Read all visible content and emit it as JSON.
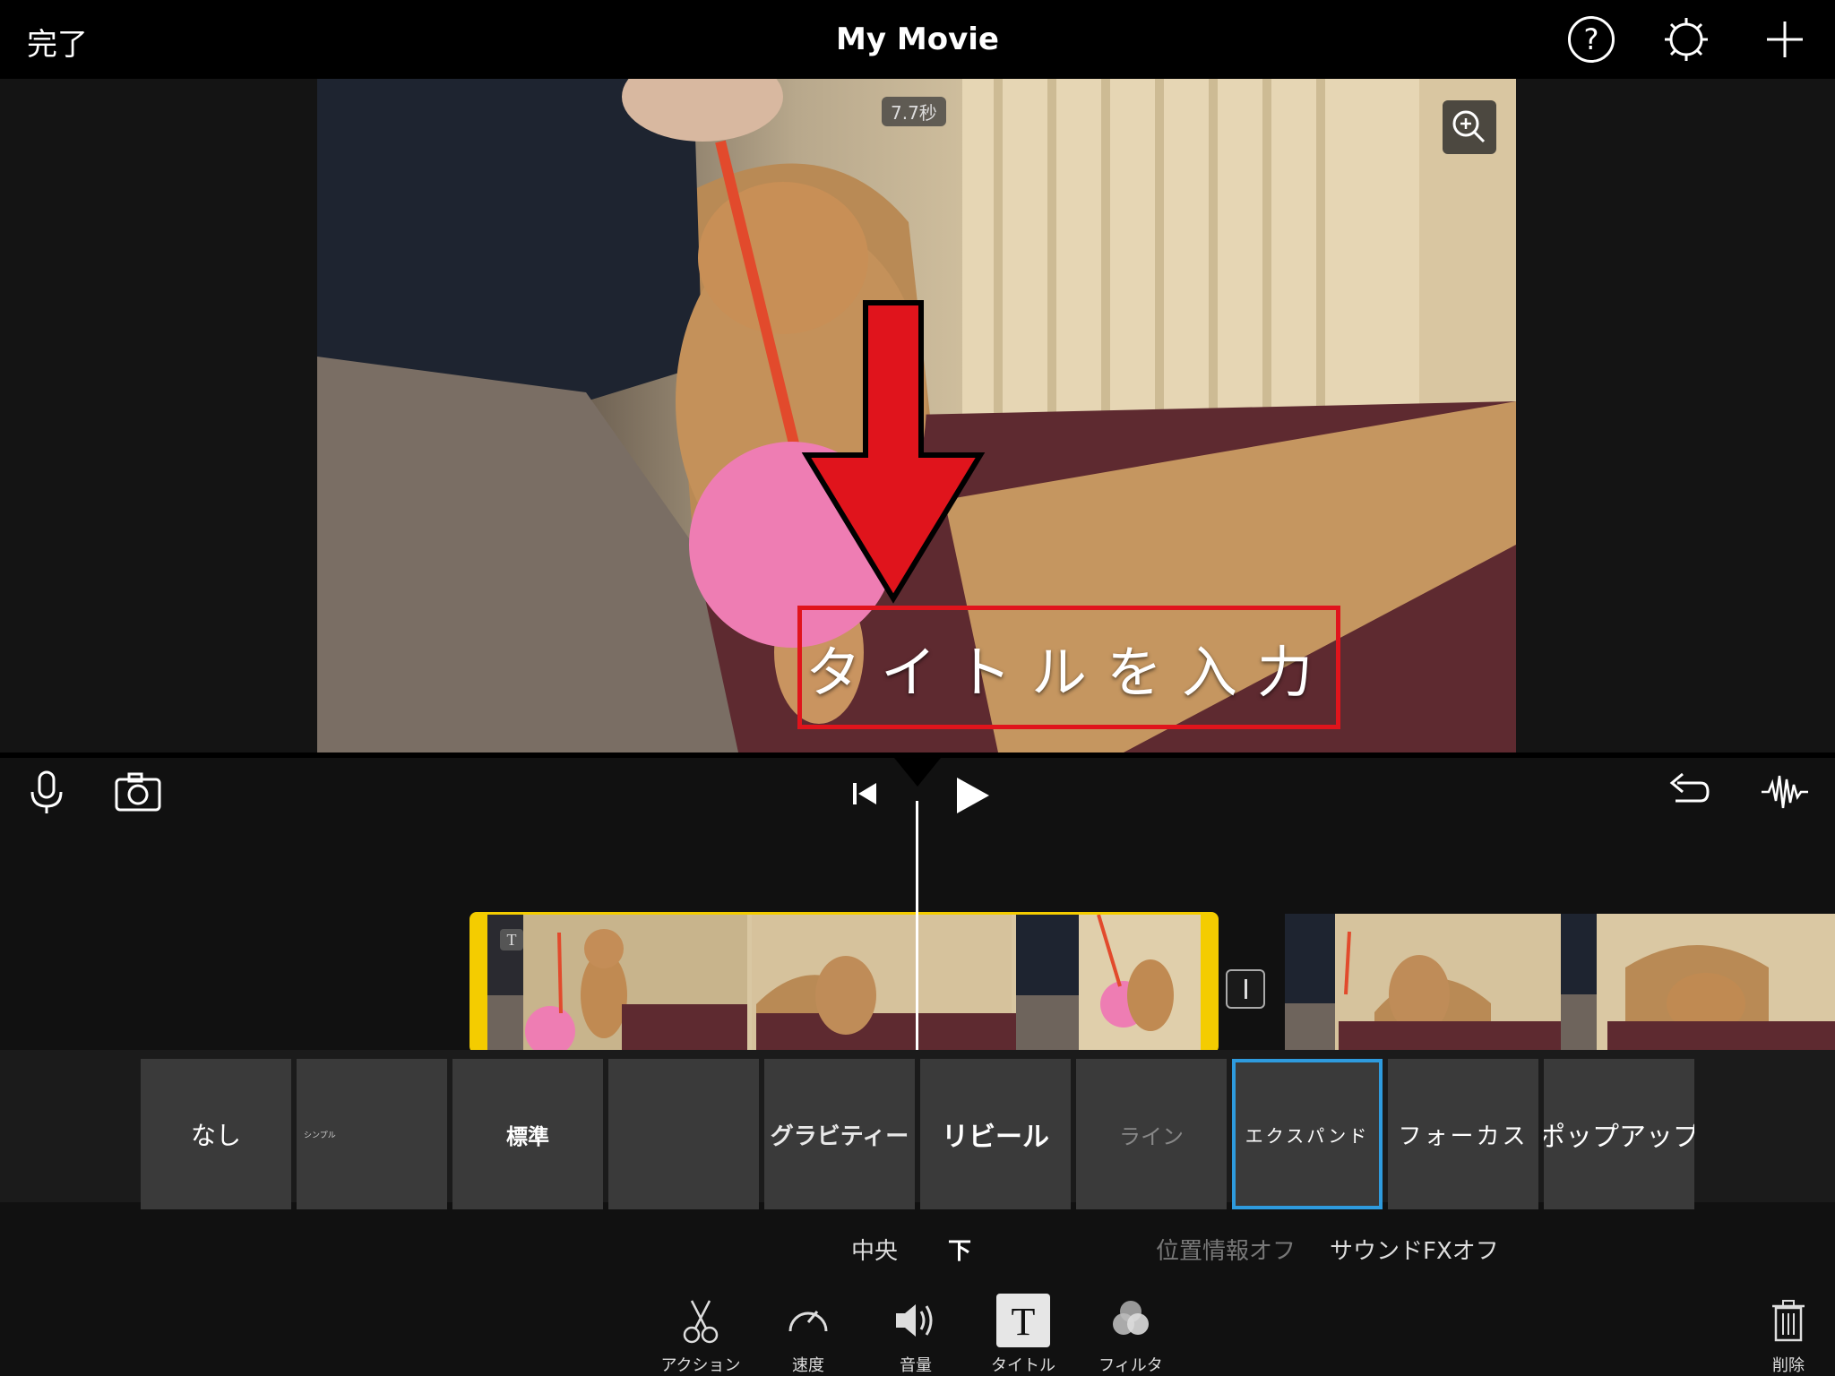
{
  "top_bar": {
    "done_label": "完了",
    "title": "My Movie",
    "help_label": "?"
  },
  "viewer": {
    "duration": "7.7秒",
    "title_placeholder": "タイトルを入力"
  },
  "title_styles": [
    {
      "label": "なし"
    },
    {
      "label": "シンプル"
    },
    {
      "label": "標準"
    },
    {
      "label": ""
    },
    {
      "label": "グラビティー"
    },
    {
      "label": "リビール"
    },
    {
      "label": "ライン"
    },
    {
      "label": "エクスパンド",
      "selected": true
    },
    {
      "label": "フォーカス"
    },
    {
      "label": "ポップアップ"
    }
  ],
  "position_options": {
    "center": "中央",
    "bottom": "下",
    "location_info": "位置情報オフ",
    "sound_fx": "サウンドFXオフ"
  },
  "toolbar": {
    "action": "アクション",
    "speed": "速度",
    "volume": "音量",
    "title": "タイトル",
    "filter": "フィルタ",
    "delete": "削除"
  },
  "colors": {
    "accent_yellow": "#f4cc00",
    "selected_blue": "#2e9bde",
    "annotation_red": "#e0141c"
  }
}
